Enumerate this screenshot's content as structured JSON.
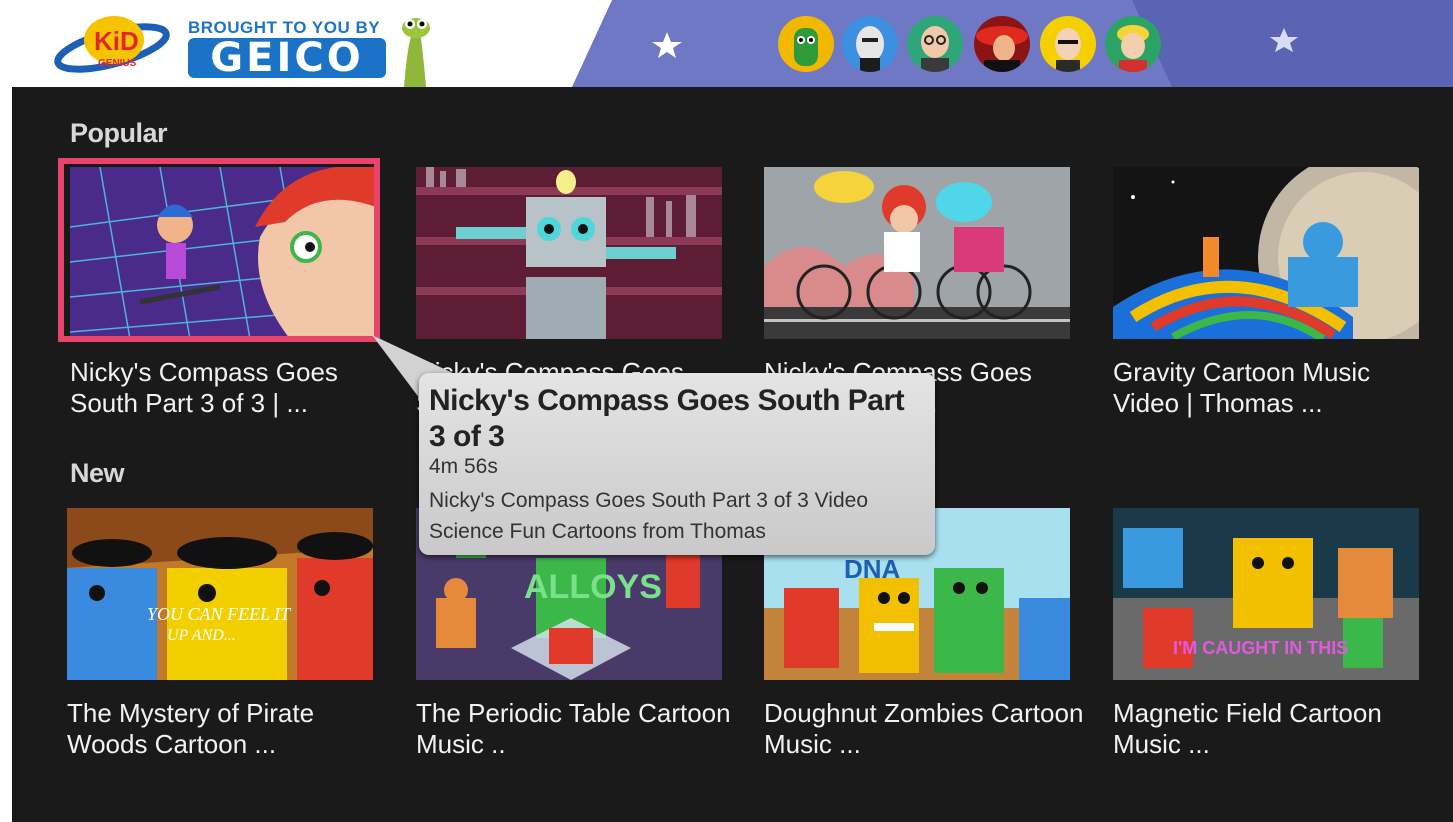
{
  "header": {
    "logo_text": "KiD",
    "logo_subtext": "GENIUS",
    "sponsor_line1": "BROUGHT TO YOU BY",
    "sponsor_brand": "GEICO",
    "banner_color": "#6f78c4",
    "characters": [
      "green-clay-character",
      "bald-professor",
      "man-with-glasses",
      "woman-red-hat",
      "man-yellow-background",
      "blond-boy"
    ]
  },
  "sections": [
    {
      "title": "Popular",
      "items": [
        {
          "title": "Nicky's Compass Goes South Part 3 of 3 | ...",
          "selected": true
        },
        {
          "title": "Nicky's Compass Goes South Part 2 ..."
        },
        {
          "title": "Nicky's Compass Goes South Part 1 ..."
        },
        {
          "title": "Gravity Cartoon Music Video | Thomas ..."
        }
      ]
    },
    {
      "title": "New",
      "items": [
        {
          "title": "The Mystery of Pirate Woods Cartoon ..."
        },
        {
          "title": "The Periodic Table Cartoon Music .."
        },
        {
          "title": "Doughnut Zombies Cartoon Music ..."
        },
        {
          "title": "Magnetic Field Cartoon Music ..."
        }
      ]
    }
  ],
  "thumb_text": {
    "pirate_caption_1": "YOU CAN FEEL IT",
    "pirate_caption_2": "UP AND...",
    "periodic_caption": "ALLOYS",
    "zombies_caption": "DNA",
    "magnetic_caption": "I'M CAUGHT IN THIS"
  },
  "tooltip": {
    "title": "Nicky's Compass Goes South Part 3 of 3",
    "duration": "4m 56s",
    "description": "Nicky's Compass Goes South Part 3 of 3 Video Science Fun Cartoons from Thomas"
  },
  "colors": {
    "background": "#1a1a1a",
    "selection": "#e8446b",
    "title_text": "#f2f2f2",
    "section_text": "#d8d8d8",
    "tooltip_bg": "#d6d6d6"
  }
}
